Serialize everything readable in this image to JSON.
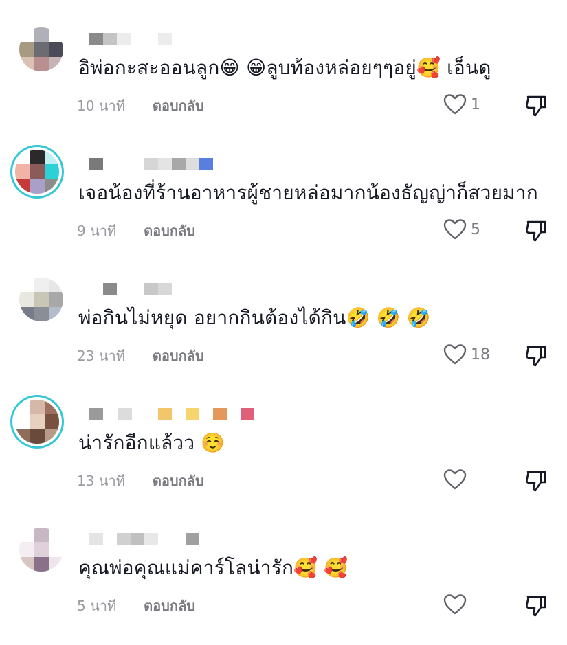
{
  "comments": [
    {
      "text": "อิพ่อกะสะออนลูก😁 😁ลูบท้องหล่อยๆๆอยู่🥰 เอ็นดู",
      "time": "10 นาที",
      "reply": "ตอบกลับ",
      "likes": "1"
    },
    {
      "text": "เจอน้องที่ร้านอาหารผู้ชายหล่อมากน้องธัญญ่าก็สวยมาก",
      "time": "9 นาที",
      "reply": "ตอบกลับ",
      "likes": "5"
    },
    {
      "text": "พ่อกินไม่หยุด อยากกินต้องได้กิน🤣 🤣 🤣",
      "time": "23 นาที",
      "reply": "ตอบกลับ",
      "likes": "18"
    },
    {
      "text": "น่ารักอีกแล้วว ☺️",
      "time": "13 นาที",
      "reply": "ตอบกลับ",
      "likes": ""
    },
    {
      "text": "คุณพ่อคุณแม่คาร์โลน่ารัก🥰 🥰",
      "time": "5 นาที",
      "reply": "ตอบกลับ",
      "likes": ""
    }
  ],
  "icons": {
    "like": "heart-outline-icon",
    "dislike": "thumbs-down-icon"
  },
  "colors": {
    "ring": "#35c7d6",
    "meta": "#9a9ba0",
    "reply": "#7a7b80"
  }
}
